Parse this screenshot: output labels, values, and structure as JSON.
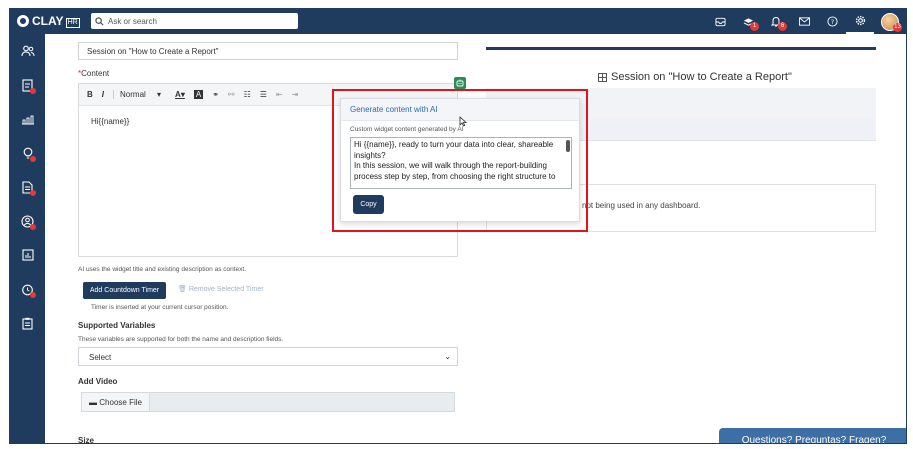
{
  "brand": {
    "name": "CLAY",
    "suffix": "HR"
  },
  "search": {
    "placeholder": "Ask or search"
  },
  "topbar": {
    "icons": [
      "inbox-icon",
      "layers-icon",
      "bell-icon",
      "mail-icon",
      "help-icon",
      "gear-icon"
    ],
    "badges": {
      "layers": "1",
      "bell": "6",
      "avatar": "13"
    }
  },
  "sidebar": {
    "items": [
      "users-icon",
      "tasks-icon",
      "analytics-icon",
      "ideas-icon",
      "documents-icon",
      "profile-icon",
      "reports-icon",
      "timer-icon",
      "clipboard-icon"
    ]
  },
  "form": {
    "title_value": "Session on \"How to Create a Report\"",
    "content_label": "Content",
    "required_mark": "*",
    "toolbar": {
      "bold": "B",
      "italic": "I",
      "style": "Normal"
    },
    "editor_text": "Hi{{name}}",
    "ai_note": "AI uses the widget title and existing description as context.",
    "countdown_button": "Add Countdown Timer",
    "remove_timer": "Remove Selected Timer",
    "timer_note": "Timer is inserted at your current cursor position.",
    "supported_variables_label": "Supported Variables",
    "supported_variables_note": "These variables are supported for both the name and description fields.",
    "select_value": "Select",
    "add_video_label": "Add Video",
    "choose_file": "Choose File",
    "size_label": "Size"
  },
  "preview": {
    "title": "Session on \"How to Create a Report\"",
    "not_used_text": "not being used in any dashboard."
  },
  "ai_popup": {
    "title": "Generate content with AI",
    "subtitle": "Custom widget content generated by AI",
    "generated_text": "Hi {{name}}, ready to turn your data into clear, shareable insights?\nIn this session, we will walk through the report-building process step by step, from choosing the right structure to",
    "copy_button": "Copy"
  },
  "help": {
    "label": "Questions? Preguntas? Fragen?"
  },
  "colors": {
    "navy": "#1f3b5e",
    "highlight": "#e0141e",
    "badge": "#e53935",
    "help": "#3d6fa5"
  }
}
